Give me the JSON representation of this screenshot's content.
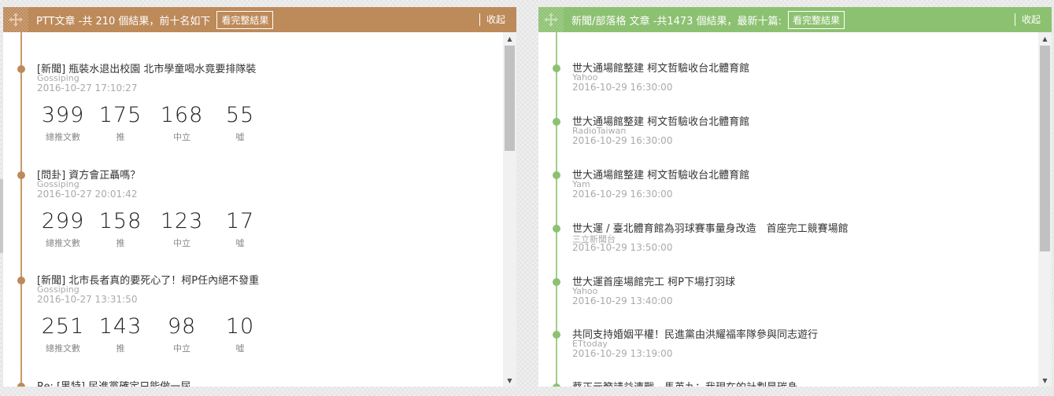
{
  "ptt": {
    "title": "PTT文章 -共 210 個結果，前十名如下",
    "full_results_label": "看完整結果",
    "collapse_label": "收起",
    "stat_labels": [
      "總推文數",
      "推",
      "中立",
      "噓"
    ],
    "items": [
      {
        "title": "[新聞] 瓶裝水退出校園 北市學童喝水竟要排隊裝",
        "board": "Gossiping",
        "date": "2016-10-27 17:10:27",
        "stats": [
          "399",
          "175",
          "168",
          "55"
        ]
      },
      {
        "title": "[問卦] 資方會正聶嗎？",
        "board": "Gossiping",
        "date": "2016-10-27 20:01:42",
        "stats": [
          "299",
          "158",
          "123",
          "17"
        ]
      },
      {
        "title": "[新聞] 北市長者真的要死心了！柯P任內絕不發重",
        "board": "Gossiping",
        "date": "2016-10-27 13:31:50",
        "stats": [
          "251",
          "143",
          "98",
          "10"
        ]
      },
      {
        "title": "Re: [黑特] 民進黨確定只能做一屆",
        "board": "",
        "date": "",
        "stats": []
      }
    ]
  },
  "news": {
    "title": "新聞/部落格 文章 -共1473 個結果，最新十篇:",
    "full_results_label": "看完整結果",
    "collapse_label": "收起",
    "items": [
      {
        "title": "世大通場館整建 柯文哲驗收台北體育館",
        "source": "Yahoo",
        "date": "2016-10-29 16:30:00"
      },
      {
        "title": "世大通場館整建 柯文哲驗收台北體育館",
        "source": "RadioTaiwan",
        "date": "2016-10-29 16:30:00"
      },
      {
        "title": "世大通場館整建 柯文哲驗收台北體育館",
        "source": "Yam",
        "date": "2016-10-29 16:30:00"
      },
      {
        "title": "世大運 / 臺北體育館為羽球賽事量身改造　首座完工競賽場館",
        "source": "三立新聞台",
        "date": "2016-10-29 13:50:00"
      },
      {
        "title": "世大運首座場館完工 柯P下場打羽球",
        "source": "Yahoo",
        "date": "2016-10-29 13:40:00"
      },
      {
        "title": "共同支持婚姻平權！民進黨由洪耀福率隊參與同志遊行",
        "source": "ETtoday",
        "date": "2016-10-29 13:19:00"
      },
      {
        "title": "蔡正元籲請益連戰　馬英九：我現在的計劃是碳身",
        "source": "",
        "date": ""
      }
    ]
  },
  "colors": {
    "ptt_accent": "#bd8a5a",
    "news_accent": "#8dc172"
  },
  "icons": {
    "drag_handle": "move-cross-icon",
    "scroll_up": "triangle-up-icon",
    "scroll_down": "triangle-down-icon"
  }
}
